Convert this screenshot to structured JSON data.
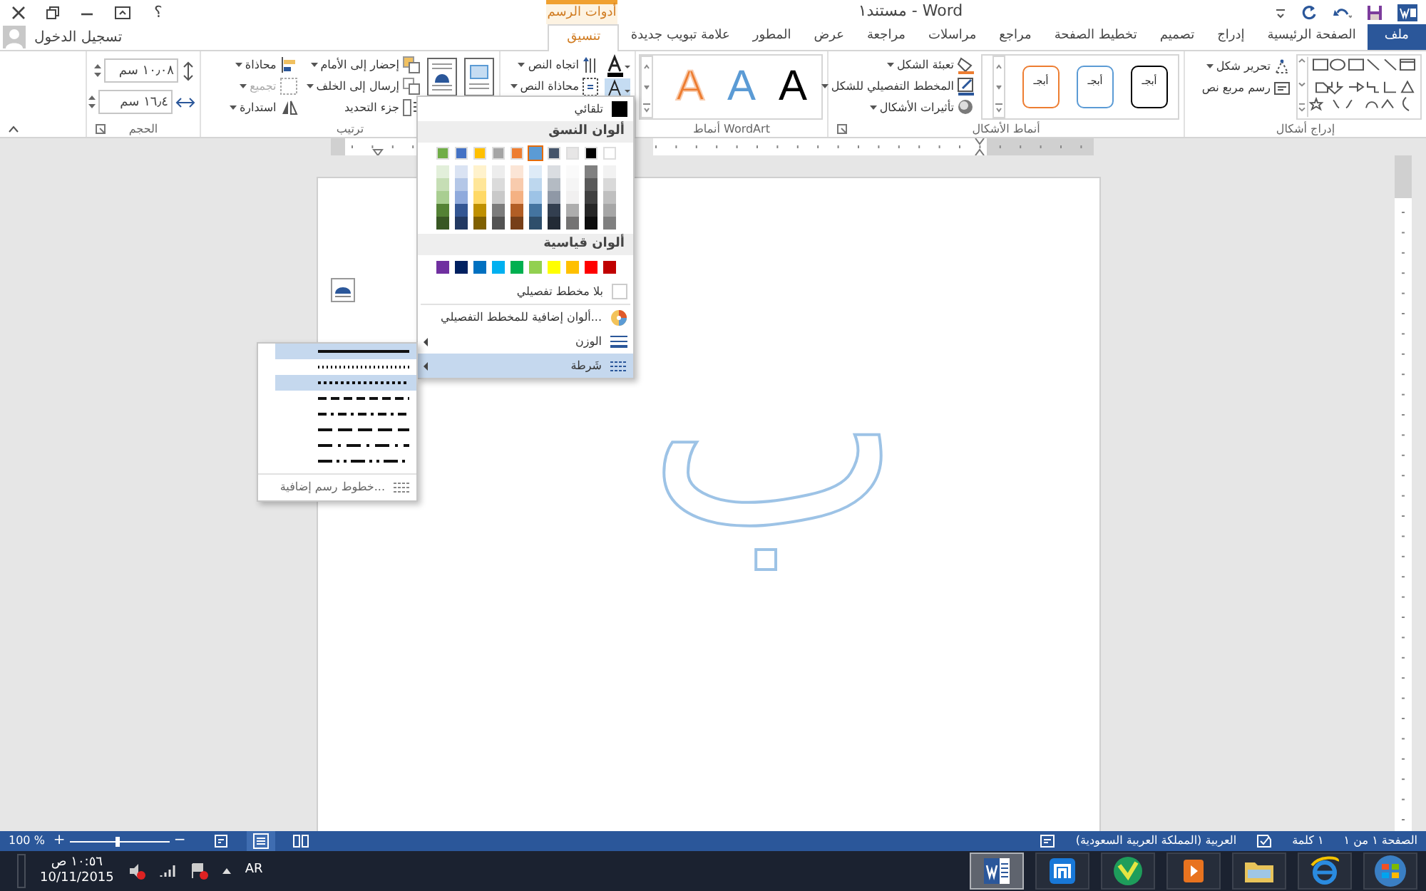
{
  "window": {
    "title": "مستند١ - Word",
    "contextual_group": "أدوات الرسم",
    "help": "؟"
  },
  "tabs": [
    {
      "label": "ملف",
      "kind": "file",
      "selected": false
    },
    {
      "label": "الصفحة الرئيسية",
      "kind": "tab",
      "selected": false
    },
    {
      "label": "إدراج",
      "kind": "tab",
      "selected": false
    },
    {
      "label": "تصميم",
      "kind": "tab",
      "selected": false
    },
    {
      "label": "تخطيط الصفحة",
      "kind": "tab",
      "selected": false
    },
    {
      "label": "مراجع",
      "kind": "tab",
      "selected": false
    },
    {
      "label": "مراسلات",
      "kind": "tab",
      "selected": false
    },
    {
      "label": "مراجعة",
      "kind": "tab",
      "selected": false
    },
    {
      "label": "عرض",
      "kind": "tab",
      "selected": false
    },
    {
      "label": "المطور",
      "kind": "tab",
      "selected": false
    },
    {
      "label": "علامة تبويب جديدة",
      "kind": "tab",
      "selected": false
    },
    {
      "label": "تنسيق",
      "kind": "contextual",
      "selected": true
    }
  ],
  "account": {
    "label": "تسجيل الدخول"
  },
  "ribbon": {
    "insert_shapes": {
      "label": "إدراج أشكال",
      "edit_shape": "تحرير شكل",
      "draw_text_box": "رسم مربع نص"
    },
    "shape_styles": {
      "label": "أنماط الأشكال",
      "samples": [
        {
          "text": "أبجـ",
          "color": "#000000"
        },
        {
          "text": "أبجـ",
          "color": "#5b9bd5"
        },
        {
          "text": "أبجـ",
          "color": "#ed7d31"
        }
      ],
      "fill": "تعبئة الشكل",
      "outline": "المخطط التفصيلي للشكل",
      "effects": "تأثيرات الأشكال"
    },
    "wordart": {
      "label": "أنماط WordArt",
      "samples": [
        {
          "text": "A",
          "color": "#000000",
          "kind": "fill"
        },
        {
          "text": "A",
          "color": "#5b9bd5",
          "kind": "fill"
        },
        {
          "text": "A",
          "color": "#ed7d31",
          "kind": "outline"
        }
      ]
    },
    "text": {
      "direction": "اتجاه النص",
      "align": "محاذاة النص"
    },
    "arrange": {
      "label": "ترتيب",
      "bring_forward": "إحضار إلى الأمام",
      "send_backward": "إرسال إلى الخلف",
      "selection_pane": "جزء التحديد",
      "align": "محاذاة",
      "group": "تجميع",
      "group_disabled": true,
      "rotate": "استدارة"
    },
    "size": {
      "label": "الحجم",
      "height": "١٠٫٠٨ سم",
      "width": "١٦٫٤ سم"
    }
  },
  "document": {
    "shape_text": "ب"
  },
  "outline_menu": {
    "automatic": "تلقائي",
    "theme_heading": "ألوان النسق",
    "theme_colors": [
      {
        "color": "#ffffff",
        "selected": false
      },
      {
        "color": "#000000",
        "selected": false
      },
      {
        "color": "#e7e6e6",
        "selected": false
      },
      {
        "color": "#44546a",
        "selected": false
      },
      {
        "color": "#5b9bd5",
        "selected": true
      },
      {
        "color": "#ed7d31",
        "selected": false
      },
      {
        "color": "#a5a5a5",
        "selected": false
      },
      {
        "color": "#ffc000",
        "selected": false
      },
      {
        "color": "#4472c4",
        "selected": false
      },
      {
        "color": "#70ad47",
        "selected": false
      }
    ],
    "standard_heading": "ألوان قياسية",
    "standard_colors": [
      {
        "color": "#c00000"
      },
      {
        "color": "#ff0000"
      },
      {
        "color": "#ffc000"
      },
      {
        "color": "#ffff00"
      },
      {
        "color": "#92d050"
      },
      {
        "color": "#00b050"
      },
      {
        "color": "#00b0f0"
      },
      {
        "color": "#0070c0"
      },
      {
        "color": "#002060"
      },
      {
        "color": "#7030a0"
      }
    ],
    "items": [
      {
        "label": "بلا مخطط تفصيلي",
        "kind": "none",
        "highlighted": false
      },
      {
        "label": "ألوان إضافية للمخطط التفصيلي...",
        "kind": "more",
        "highlighted": false
      },
      {
        "label": "الوزن",
        "kind": "weight",
        "highlighted": false
      },
      {
        "label": "شَرطة",
        "kind": "dash",
        "highlighted": true
      }
    ]
  },
  "dash_menu": {
    "options": [
      {
        "kind": "solid",
        "highlighted": true
      },
      {
        "kind": "round-dot",
        "highlighted": false
      },
      {
        "kind": "square-dot",
        "highlighted": true
      },
      {
        "kind": "dash",
        "highlighted": false
      },
      {
        "kind": "dash-dot",
        "highlighted": false
      },
      {
        "kind": "long-dash",
        "highlighted": false
      },
      {
        "kind": "long-dash-dot",
        "highlighted": false
      },
      {
        "kind": "long-dash-dot-dot",
        "highlighted": false
      }
    ],
    "more": "خطوط رسم إضافية..."
  },
  "status_bar": {
    "page": "الصفحة ١ من ١",
    "words": "١ كلمة",
    "language": "العربية (المملكة العربية السعودية)",
    "zoom": "100 %",
    "zoom_in": "+",
    "zoom_out": "−",
    "zoom_slider": {
      "level": 0.5
    }
  },
  "taskbar": {
    "apps": [
      {
        "kind": "start",
        "selected": false
      },
      {
        "kind": "ie",
        "selected": false
      },
      {
        "kind": "folder",
        "selected": false
      },
      {
        "kind": "media",
        "selected": false
      },
      {
        "kind": "green",
        "selected": false
      },
      {
        "kind": "maxthon",
        "selected": false
      },
      {
        "kind": "word",
        "selected": true
      }
    ],
    "language": "AR",
    "time": "١٠:٥٦ ص",
    "date": "10/11/2015"
  }
}
